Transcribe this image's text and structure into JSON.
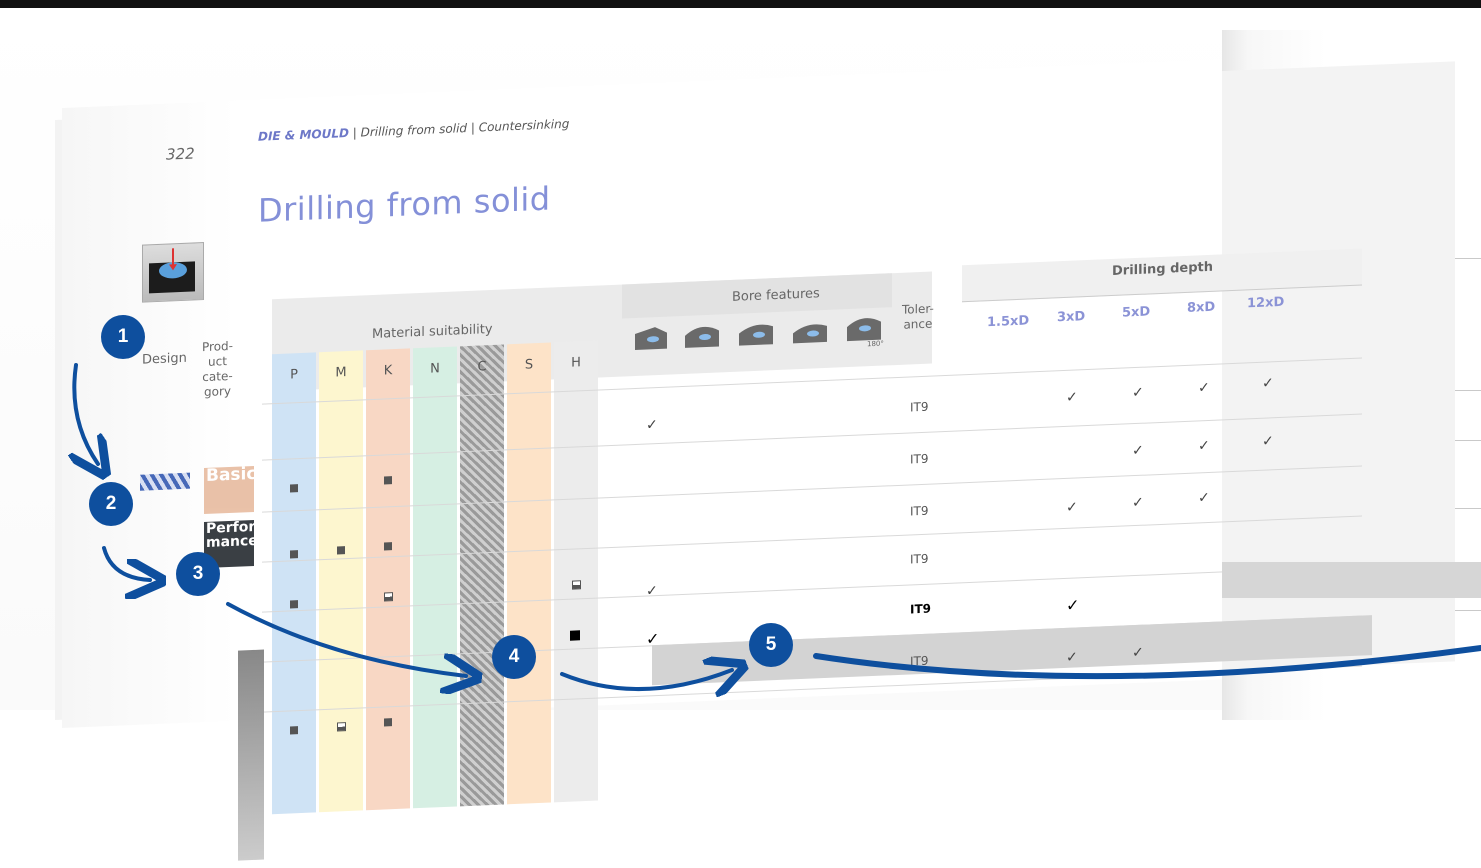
{
  "page_number": "322",
  "breadcrumb": {
    "brand": "DIE & MOULD",
    "rest": " | Drilling from solid | Countersinking"
  },
  "title": "Drilling from solid",
  "headers": {
    "design": "Design",
    "product_category": "Prod-\nuct\ncate-\ngory",
    "material_suitability": "Material suitability",
    "bore_features": "Bore features",
    "tolerance": "Toler-\nance",
    "drilling_depth": "Drilling depth"
  },
  "materials": [
    {
      "label": "P",
      "color": "#cfe3f5"
    },
    {
      "label": "M",
      "color": "#fdf6cf"
    },
    {
      "label": "K",
      "color": "#f8d7c4"
    },
    {
      "label": "N",
      "color": "#d6efe3"
    },
    {
      "label": "C",
      "color": "#bdbdbd"
    },
    {
      "label": "S",
      "color": "#fde3c8"
    },
    {
      "label": "H",
      "color": "#ececec"
    }
  ],
  "bore_icon_label": "180°",
  "depths": [
    "1.5xD",
    "3xD",
    "5xD",
    "8xD",
    "12xD"
  ],
  "product_lines": [
    "Basic",
    "Perfor\nmance"
  ],
  "rows": [
    {
      "tolerance": "IT9"
    },
    {
      "tolerance": "IT9"
    },
    {
      "tolerance": "IT9"
    },
    {
      "tolerance": "IT9"
    },
    {
      "tolerance": "IT9"
    },
    {
      "tolerance": "IT9"
    }
  ],
  "steps": [
    "1",
    "2",
    "3",
    "4",
    "5"
  ],
  "colors": {
    "accent": "#0e4f9e",
    "title": "#8490d8",
    "depth": "#8b93d6"
  }
}
